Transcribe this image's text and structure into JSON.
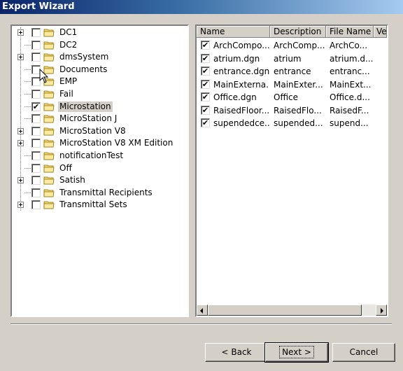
{
  "window": {
    "title": "Export Wizard"
  },
  "tree": {
    "items": [
      {
        "label": "DC1",
        "expandable": true,
        "checked": false,
        "selected": false
      },
      {
        "label": "DC2",
        "expandable": false,
        "checked": false,
        "selected": false
      },
      {
        "label": "dmsSystem",
        "expandable": true,
        "checked": false,
        "selected": false
      },
      {
        "label": "Documents",
        "expandable": false,
        "checked": false,
        "selected": false
      },
      {
        "label": "EMP",
        "expandable": false,
        "checked": false,
        "selected": false
      },
      {
        "label": "Fail",
        "expandable": false,
        "checked": false,
        "selected": false
      },
      {
        "label": "Microstation",
        "expandable": false,
        "checked": true,
        "selected": true
      },
      {
        "label": "MicroStation J",
        "expandable": false,
        "checked": false,
        "selected": false
      },
      {
        "label": "MicroStation V8",
        "expandable": true,
        "checked": false,
        "selected": false
      },
      {
        "label": "MicroStation V8 XM Edition",
        "expandable": true,
        "checked": false,
        "selected": false
      },
      {
        "label": "notificationTest",
        "expandable": false,
        "checked": false,
        "selected": false
      },
      {
        "label": "Off",
        "expandable": false,
        "checked": false,
        "selected": false
      },
      {
        "label": "Satish",
        "expandable": true,
        "checked": false,
        "selected": false
      },
      {
        "label": "Transmittal Recipients",
        "expandable": false,
        "checked": false,
        "selected": false
      },
      {
        "label": "Transmittal Sets",
        "expandable": true,
        "checked": false,
        "selected": false
      }
    ]
  },
  "list": {
    "columns": [
      "Name",
      "Description",
      "File Name",
      "Ve"
    ],
    "rows": [
      {
        "name": "ArchCompo...",
        "description": "ArchComp...",
        "file": "ArchCo...",
        "checked": true
      },
      {
        "name": "atrium.dgn",
        "description": "atrium",
        "file": "atrium.d...",
        "checked": true
      },
      {
        "name": "entrance.dgn",
        "description": "entrance",
        "file": "entranc...",
        "checked": true
      },
      {
        "name": "MainExterna...",
        "description": "MainExter...",
        "file": "MainExt...",
        "checked": true
      },
      {
        "name": "Office.dgn",
        "description": "Office",
        "file": "Office.d...",
        "checked": true
      },
      {
        "name": "RaisedFloor...",
        "description": "RaisedFlo...",
        "file": "RaisedF...",
        "checked": true
      },
      {
        "name": "supendedce...",
        "description": "supended...",
        "file": "supend...",
        "checked": true
      }
    ]
  },
  "buttons": {
    "back": "< Back",
    "next": "Next >",
    "cancel": "Cancel"
  },
  "colors": {
    "titlebar_start": "#0a246a",
    "titlebar_end": "#a6caf0",
    "folder": "#f5d76e",
    "dialog": "#d4d0c8"
  },
  "icons": {
    "folder": "folder-icon",
    "expand": "plus-expander-icon",
    "checkbox_mark": "✔"
  }
}
